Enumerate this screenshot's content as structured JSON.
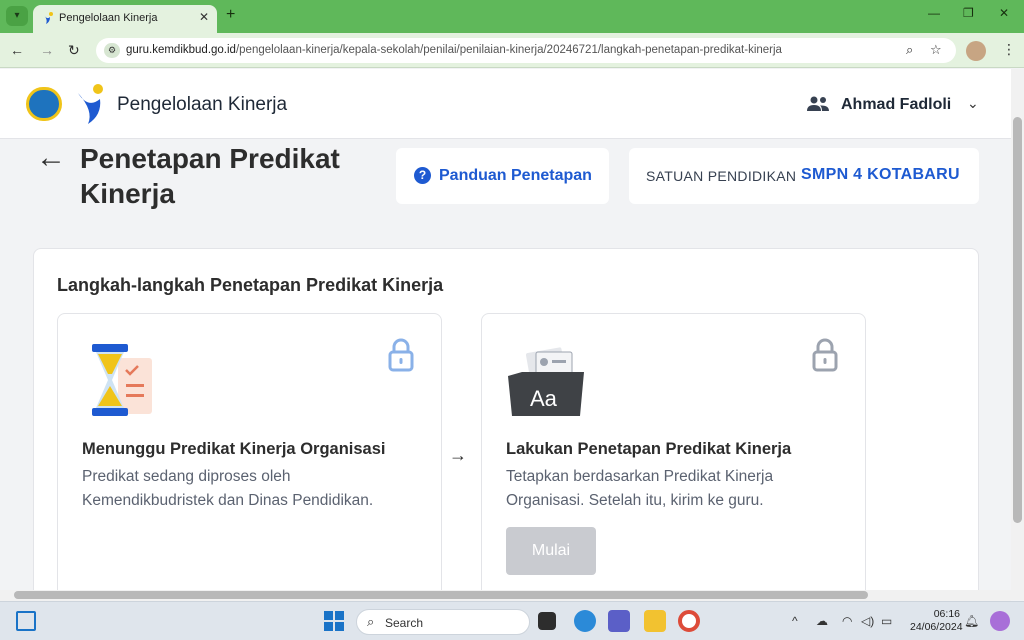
{
  "browser": {
    "tab_title": "Pengelolaan Kinerja",
    "url_host": "guru.kemdikbud.go.id",
    "url_path": "/pengelolaan-kinerja/kepala-sekolah/penilai/penilaian-kinerja/20246721/langkah-penetapan-predikat-kinerja"
  },
  "header": {
    "app_title": "Pengelolaan Kinerja",
    "user_name": "Ahmad Fadloli"
  },
  "page": {
    "title": "Penetapan Predikat Kinerja",
    "guide_label": "Panduan Penetapan",
    "unit_label": "SATUAN PENDIDIKAN",
    "unit_value": "SMPN 4 KOTABARU"
  },
  "steps": {
    "heading": "Langkah-langkah Penetapan Predikat Kinerja",
    "items": [
      {
        "title": "Menunggu Predikat Kinerja Organisasi",
        "desc": "Predikat sedang diproses oleh Kemendikbudristek dan Dinas Pendidikan."
      },
      {
        "title": "Lakukan Penetapan Predikat Kinerja",
        "desc": "Tetapkan berdasarkan Predikat Kinerja Organisasi. Setelah itu, kirim ke guru.",
        "button_label": "Mulai",
        "illus_text": "Aa"
      }
    ]
  },
  "taskbar": {
    "search_label": "Search",
    "time": "06:16",
    "date": "24/06/2024"
  },
  "colors": {
    "primary": "#1e5ad1",
    "tabbar": "#5fb85a",
    "disabled_button": "#c9cbd0"
  }
}
